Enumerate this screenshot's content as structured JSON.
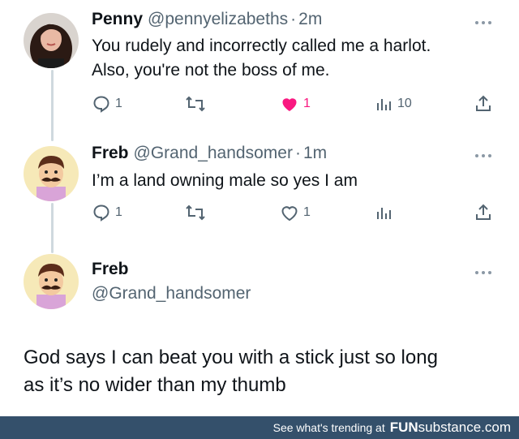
{
  "tweets": [
    {
      "name": "Penny",
      "handle": "@pennyelizabeths",
      "dot": "·",
      "time": "2m",
      "lines": [
        "You rudely and incorrectly called me a harlot.",
        "Also, you're not the boss of me."
      ],
      "replies": "1",
      "retweets": "",
      "likes": "1",
      "liked": true,
      "views": "10"
    },
    {
      "name": "Freb",
      "handle": "@Grand_handsomer",
      "dot": "·",
      "time": "1m",
      "lines": [
        "I’m a land owning male so yes I am"
      ],
      "replies": "1",
      "retweets": "",
      "likes": "1",
      "liked": false,
      "views": ""
    }
  ],
  "main_tweet": {
    "name": "Freb",
    "handle": "@Grand_handsomer",
    "lines": [
      "God says I can beat you with a stick just so long",
      "as it’s no wider than my thumb"
    ]
  },
  "footer": {
    "text": "See what's trending at",
    "brand_bold": "FUN",
    "brand_rest": "substance",
    "brand_tld": ".com"
  },
  "colors": {
    "like_active": "#f91880",
    "muted": "#536471",
    "footer_bg": "#34506b",
    "thread_line": "#cfd9de"
  },
  "icons": [
    "reply-icon",
    "retweet-icon",
    "heart-icon",
    "views-icon",
    "share-icon",
    "more-icon"
  ]
}
